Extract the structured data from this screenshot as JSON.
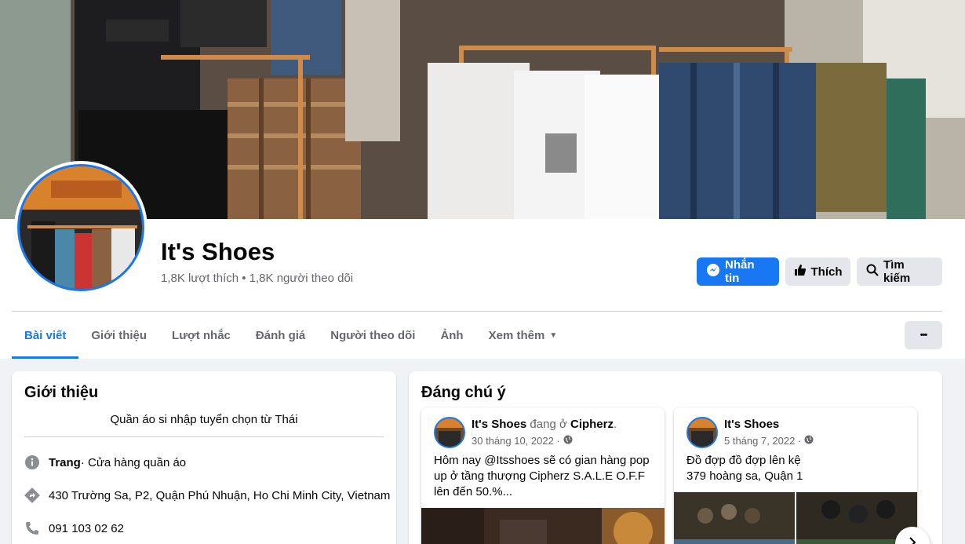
{
  "page": {
    "name": "It's Shoes",
    "stats": "1,8K lượt thích • 1,8K người theo dõi"
  },
  "actions": {
    "message": "Nhắn tin",
    "like": "Thích",
    "search": "Tìm kiếm"
  },
  "tabs": [
    {
      "label": "Bài viết"
    },
    {
      "label": "Giới thiệu"
    },
    {
      "label": "Lượt nhắc"
    },
    {
      "label": "Đánh giá"
    },
    {
      "label": "Người theo dõi"
    },
    {
      "label": "Ảnh"
    },
    {
      "label": "Xem thêm"
    }
  ],
  "more_label": "•••",
  "intro": {
    "title": "Giới thiệu",
    "description": "Quần áo si nhập tuyển chọn từ Thái",
    "category_prefix": "Trang",
    "category": " · Cửa hàng quần áo",
    "address": "430 Trường Sa, P2, Quận Phú Nhuận, Ho Chi Minh City, Vietnam",
    "phone": "091 103 02 62"
  },
  "featured": {
    "title": "Đáng chú ý",
    "posts": [
      {
        "author": "It's Shoes",
        "at_text": " đang ở ",
        "place": "Cipherz",
        "date": "30 tháng 10, 2022 ·",
        "text": "Hôm nay @Itsshoes sẽ có gian hàng pop up ở tầng thượng Cipherz S.A.L.E O.F.F lên đến 50.%..."
      },
      {
        "author": "It's Shoes",
        "date": "5 tháng 7, 2022 ·",
        "text": "Đồ đợp đồ đợp lên kệ\n379 hoàng sa, Quận 1"
      }
    ]
  },
  "colors": {
    "accent": "#1877f2",
    "muted": "#65676b",
    "button_gray": "#e4e6eb"
  }
}
